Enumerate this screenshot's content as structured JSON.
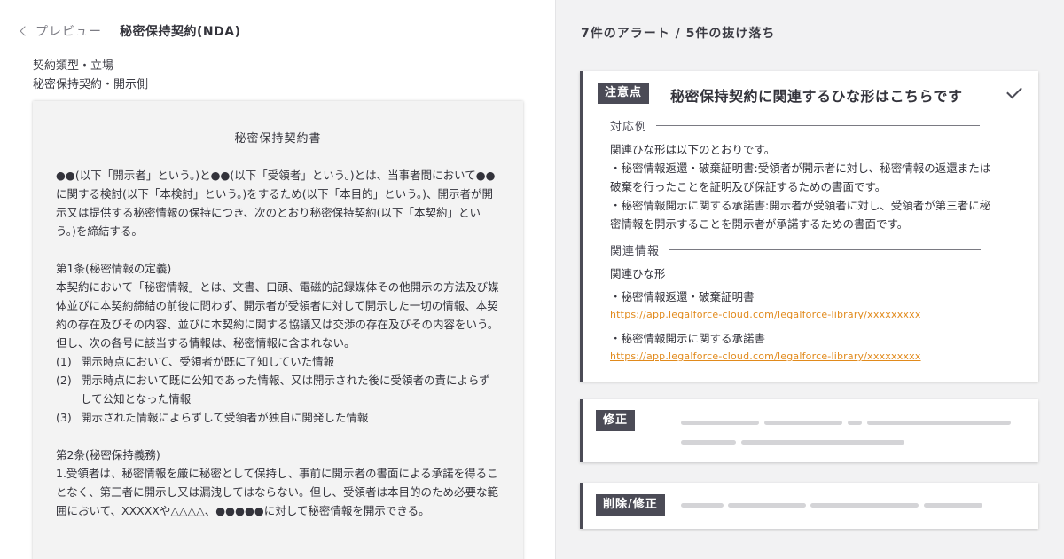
{
  "header": {
    "back_label": "プレビュー",
    "doc_title": "秘密保持契約(NDA)"
  },
  "meta": {
    "label": "契約類型・立場",
    "value": "秘密保持契約・開示側"
  },
  "document": {
    "title": "秘密保持契約書",
    "intro": "●●(以下「開示者」という。)と●●(以下「受領者」という。)とは、当事者間において●●に関する検討(以下「本検討」という。)をするため(以下「本目的」という。)、開示者が開示又は提供する秘密情報の保持につき、次のとおり秘密保持契約(以下「本契約」という。)を締結する。",
    "article1_heading": "第1条(秘密情報の定義)",
    "article1_body": "本契約において「秘密情報」とは、文書、口頭、電磁的記録媒体その他開示の方法及び媒体並びに本契約締結の前後に問わず、開示者が受領者に対して開示した一切の情報、本契約の存在及びその内容、並びに本契約に関する協議又は交渉の存在及びその内容をいう。但し、次の各号に該当する情報は、秘密情報に含まれない。",
    "article1_items": [
      {
        "num": "(1)",
        "text": "開示時点において、受領者が既に了知していた情報"
      },
      {
        "num": "(2)",
        "text": "開示時点において既に公知であった情報、又は開示された後に受領者の責によらずして公知となった情報"
      },
      {
        "num": "(3)",
        "text": "開示された情報によらずして受領者が独自に開発した情報"
      }
    ],
    "article2_heading": "第2条(秘密保持義務)",
    "article2_body": "1.受領者は、秘密情報を厳に秘密として保持し、事前に開示者の書面による承諾を得ることなく、第三者に開示し又は漏洩してはならない。但し、受領者は本目的のため必要な範囲において、XXXXXや△△△△、●●●●●に対して秘密情報を開示できる。"
  },
  "alerts": {
    "summary": "7件のアラート / 5件の抜け落ち",
    "card1": {
      "badge": "注意点",
      "title": "秘密保持契約に関連するひな形はこちらです",
      "section_response": "対応例",
      "response_lines": [
        "関連ひな形は以下のとおりです。",
        "・秘密情報返還・破棄証明書:受領者が開示者に対し、秘密情報の返還または破棄を行ったことを証明及び保証するための書面です。",
        "・秘密情報開示に関する承諾書:開示者が受領者に対し、受領者が第三者に秘密情報を開示することを開示者が承諾するための書面です。"
      ],
      "section_related": "関連情報",
      "related_heading": "関連ひな形",
      "links": [
        {
          "label": "・秘密情報返還・破棄証明書",
          "url": "https://app.legalforce-cloud.com/legalforce-library/xxxxxxxxx"
        },
        {
          "label": "・秘密情報開示に関する承諾書",
          "url": "https://app.legalforce-cloud.com/legalforce-library/xxxxxxxxx"
        }
      ]
    },
    "card2": {
      "badge": "修正"
    },
    "card3": {
      "badge": "削除/修正"
    }
  },
  "colors": {
    "accent": "#4b4b56",
    "link": "#e18a1c",
    "skeleton": "#d4d4d7",
    "panel_bg": "#f2f2f3",
    "paper_bg": "#f3f3f3"
  },
  "icons": {
    "back": "chevron-left-icon",
    "resolved": "check-icon"
  }
}
